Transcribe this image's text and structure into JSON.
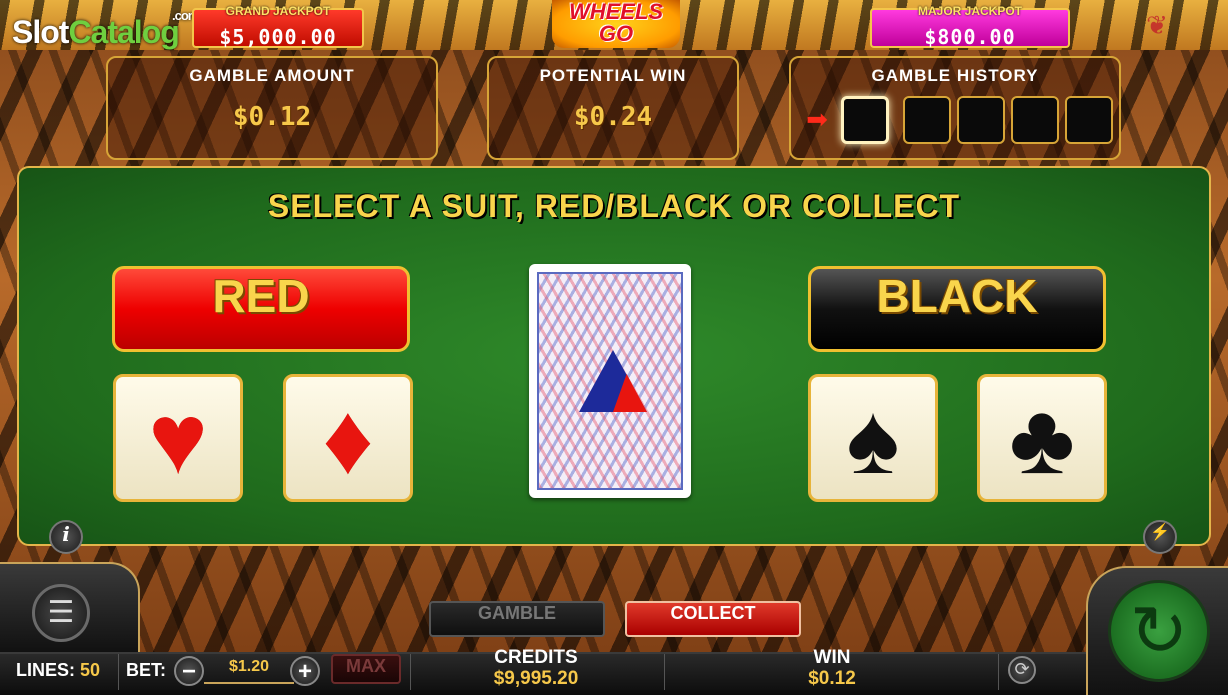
{
  "watermark": {
    "brand_a": "Slot",
    "brand_b": "Catalog",
    "tld": ".com"
  },
  "jackpots": {
    "grand": {
      "label": "GRAND JACKPOT",
      "value": "$5,000.00"
    },
    "major": {
      "label": "MAJOR JACKPOT",
      "value": "$800.00"
    }
  },
  "logo": {
    "line1": "WHEELS",
    "line2": "GO"
  },
  "panels": {
    "gamble_amount": {
      "label": "GAMBLE AMOUNT",
      "value": "$0.12"
    },
    "potential_win": {
      "label": "POTENTIAL WIN",
      "value": "$0.24"
    },
    "gamble_history": {
      "label": "GAMBLE HISTORY",
      "slots": 5,
      "active_slot": 1
    }
  },
  "table": {
    "instruction": "SELECT A SUIT, RED/BLACK OR COLLECT",
    "red_button": "RED",
    "black_button": "BLACK",
    "suits": {
      "hearts": "♥",
      "diamonds": "♦",
      "spades": "♠",
      "clubs": "♣"
    },
    "info_icon": "i",
    "turbo_icon": "⚡"
  },
  "controls": {
    "gamble_button": "GAMBLE",
    "collect_button": "COLLECT",
    "lines_label": "LINES:",
    "lines_value": "50",
    "bet_label": "BET:",
    "bet_value": "$1.20",
    "bet_minus": "−",
    "bet_plus": "+",
    "max_button": "MAX",
    "credits_label": "CREDITS",
    "credits_value": "$9,995.20",
    "win_label": "WIN",
    "win_value": "$0.12",
    "menu_icon": "☰",
    "spin_icon": "↻",
    "settings_icon": "⟳"
  },
  "colors": {
    "accent_gold": "#f6c84a",
    "table_green": "#2f8a2a",
    "red": "#e8150f",
    "frame_gold": "#d7a537"
  }
}
